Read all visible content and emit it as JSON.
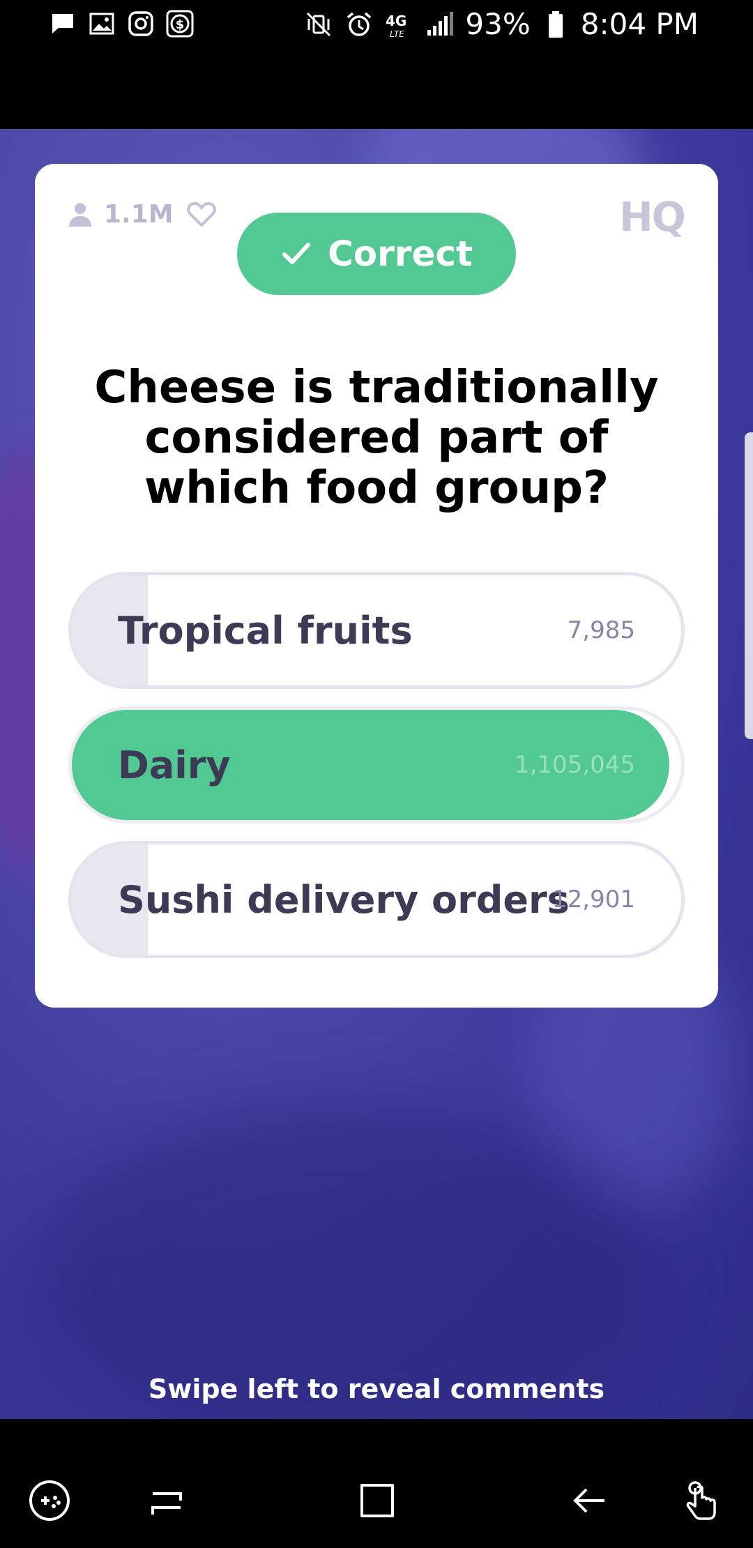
{
  "status_bar": {
    "battery": "93%",
    "time": "8:04 PM",
    "network": "4G LTE",
    "left_icons": [
      "message-icon",
      "image-icon",
      "instagram-icon",
      "cash-icon"
    ],
    "right_icons": [
      "vibrate-mute-icon",
      "alarm-icon",
      "signal-icon",
      "battery-icon"
    ]
  },
  "card": {
    "viewer_count": "1.1M",
    "brand": "HQ",
    "status_label": "Correct",
    "question": "Cheese is traditionally considered part of which food group?",
    "answers": [
      {
        "label": "Tropical fruits",
        "count": "7,985",
        "share": 0.007,
        "correct": false
      },
      {
        "label": "Dairy",
        "count": "1,105,045",
        "share": 0.981,
        "correct": true
      },
      {
        "label": "Sushi delivery orders",
        "count": "12,901",
        "share": 0.012,
        "correct": false
      }
    ]
  },
  "swipe_hint": "Swipe left to reveal comments",
  "colors": {
    "correct_green": "#52c993",
    "background_purple": "#3a369a",
    "answer_text": "#3c3a55"
  },
  "nav_bar": {
    "buttons": [
      "game-tools-icon",
      "recent-apps-icon",
      "home-icon",
      "back-icon",
      "gesture-icon"
    ]
  }
}
